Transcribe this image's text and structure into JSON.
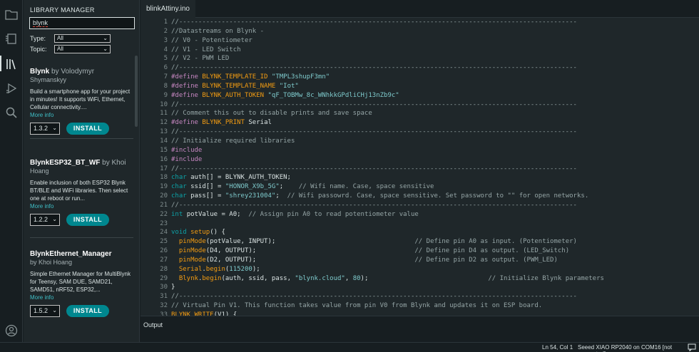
{
  "activity_bar": {
    "items": [
      {
        "name": "sketchbook-icon"
      },
      {
        "name": "boards-manager-icon"
      },
      {
        "name": "library-manager-icon"
      },
      {
        "name": "debug-icon"
      },
      {
        "name": "search-icon"
      },
      {
        "name": "profile-icon"
      }
    ]
  },
  "library_manager": {
    "title": "LIBRARY MANAGER",
    "search_value": "blynk",
    "type_label": "Type:",
    "type_value": "All",
    "topic_label": "Topic:",
    "topic_value": "All",
    "items": [
      {
        "name": "Blynk",
        "by": "by Volodymyr",
        "author": "Shymanskyy",
        "description": "Build a smartphone app for your project in minutes! It supports WiFi, Ethernet, Cellular connectivity....",
        "more": "More info",
        "version": "1.3.2",
        "install_label": "INSTALL"
      },
      {
        "name": "BlynkESP32_BT_WF",
        "by": "by Khoi",
        "author": "Hoang",
        "description": "Enable inclusion of both ESP32 Blynk BT/BLE and WiFi libraries. Then select one at reboot or run...",
        "more": "More info",
        "version": "1.2.2",
        "install_label": "INSTALL"
      },
      {
        "name": "BlynkEthernet_Manager",
        "by": "",
        "author": "by Khoi Hoang",
        "description": "Simple Ethernet Manager for MultiBlynk for Teensy, SAM DUE, SAMD21, SAMD51, nRF52, ESP32,...",
        "more": "More info",
        "version": "1.5.2",
        "install_label": "INSTALL"
      }
    ]
  },
  "editor": {
    "tab_label": "blinkAttiny.ino",
    "line_numbers": [
      "1",
      "2",
      "3",
      "4",
      "5",
      "6",
      "7",
      "8",
      "9",
      "10",
      "11",
      "12",
      "13",
      "14",
      "15",
      "16",
      "17",
      "18",
      "19",
      "20",
      "21",
      "22",
      "23",
      "24",
      "25",
      "26",
      "27",
      "28",
      "29",
      "30",
      "31",
      "32",
      "33"
    ],
    "lines": [
      [
        {
          "t": "//-------------------------------------------------------------------------------------------------------",
          "c": "c-cm"
        }
      ],
      [
        {
          "t": "//Datastreams on Blynk -",
          "c": "c-cm"
        }
      ],
      [
        {
          "t": "// V0 - Potentiometer",
          "c": "c-cm"
        }
      ],
      [
        {
          "t": "// V1 - LED Switch",
          "c": "c-cm"
        }
      ],
      [
        {
          "t": "// V2 - PWM LED",
          "c": "c-cm"
        }
      ],
      [
        {
          "t": "//-------------------------------------------------------------------------------------------------------",
          "c": "c-cm"
        }
      ],
      [
        {
          "t": "#define ",
          "c": "c-pp"
        },
        {
          "t": "BLYNK_TEMPLATE_ID ",
          "c": "c-macro"
        },
        {
          "t": "\"TMPL3shupF3mn\"",
          "c": "c-str"
        }
      ],
      [
        {
          "t": "#define ",
          "c": "c-pp"
        },
        {
          "t": "BLYNK_TEMPLATE_NAME ",
          "c": "c-macro"
        },
        {
          "t": "\"Iot\"",
          "c": "c-str"
        }
      ],
      [
        {
          "t": "#define ",
          "c": "c-pp"
        },
        {
          "t": "BLYNK_AUTH_TOKEN ",
          "c": "c-macro"
        },
        {
          "t": "\"qF_TOBMw_8c_WNhkkGPdliCHj13nZb9c\"",
          "c": "c-str"
        }
      ],
      [
        {
          "t": "//-------------------------------------------------------------------------------------------------------",
          "c": "c-cm"
        }
      ],
      [
        {
          "t": "// Comment this out to disable prints and save space",
          "c": "c-cm"
        }
      ],
      [
        {
          "t": "#define ",
          "c": "c-pp"
        },
        {
          "t": "BLYNK_PRINT ",
          "c": "c-macro"
        },
        {
          "t": "Serial",
          "c": "c-const"
        }
      ],
      [
        {
          "t": "//-------------------------------------------------------------------------------------------------------",
          "c": "c-cm"
        }
      ],
      [
        {
          "t": "// Initialize required libraries",
          "c": "c-cm"
        }
      ],
      [
        {
          "t": "#include",
          "c": "c-pp"
        }
      ],
      [
        {
          "t": "#include",
          "c": "c-pp"
        }
      ],
      [
        {
          "t": "//-------------------------------------------------------------------------------------------------------",
          "c": "c-cm"
        }
      ],
      [
        {
          "t": "char ",
          "c": "c-type"
        },
        {
          "t": "auth[] = BLYNK_AUTH_TOKEN;",
          "c": "c-const"
        }
      ],
      [
        {
          "t": "char ",
          "c": "c-type"
        },
        {
          "t": "ssid[] = ",
          "c": "c-const"
        },
        {
          "t": "\"HONOR_X9b_5G\"",
          "c": "c-str"
        },
        {
          "t": ";    ",
          "c": "c-const"
        },
        {
          "t": "// Wifi name. Case, space sensitive",
          "c": "c-cm"
        }
      ],
      [
        {
          "t": "char ",
          "c": "c-type"
        },
        {
          "t": "pass[] = ",
          "c": "c-const"
        },
        {
          "t": "\"shrey231004\"",
          "c": "c-str"
        },
        {
          "t": ";  ",
          "c": "c-const"
        },
        {
          "t": "// Wifi passowrd. Case, space sensitive. Set password to \"\" for open networks.",
          "c": "c-cm"
        }
      ],
      [
        {
          "t": "//-------------------------------------------------------------------------------------------------------",
          "c": "c-cm"
        }
      ],
      [
        {
          "t": "int ",
          "c": "c-type"
        },
        {
          "t": "potValue = A0;  ",
          "c": "c-const"
        },
        {
          "t": "// Assign pin A0 to read potentiometer value",
          "c": "c-cm"
        }
      ],
      [
        {
          "t": "",
          "c": "c-const"
        }
      ],
      [
        {
          "t": "void ",
          "c": "c-type"
        },
        {
          "t": "setup",
          "c": "c-fn"
        },
        {
          "t": "() {",
          "c": "c-const"
        }
      ],
      [
        {
          "t": "  ",
          "c": "c-const"
        },
        {
          "t": "pinMode",
          "c": "c-fn"
        },
        {
          "t": "(potValue, INPUT);                                    ",
          "c": "c-const"
        },
        {
          "t": "// Define pin A0 as input. (Potentiometer)",
          "c": "c-cm"
        }
      ],
      [
        {
          "t": "  ",
          "c": "c-const"
        },
        {
          "t": "pinMode",
          "c": "c-fn"
        },
        {
          "t": "(D4, OUTPUT);                                         ",
          "c": "c-const"
        },
        {
          "t": "// Define pin D4 as output. (LED_Switch)",
          "c": "c-cm"
        }
      ],
      [
        {
          "t": "  ",
          "c": "c-const"
        },
        {
          "t": "pinMode",
          "c": "c-fn"
        },
        {
          "t": "(D2, OUTPUT);                                         ",
          "c": "c-const"
        },
        {
          "t": "// Define pin D2 as output. (PWM_LED)",
          "c": "c-cm"
        }
      ],
      [
        {
          "t": "  ",
          "c": "c-const"
        },
        {
          "t": "Serial",
          "c": "c-fn"
        },
        {
          "t": ".",
          "c": "c-const"
        },
        {
          "t": "begin",
          "c": "c-fn"
        },
        {
          "t": "(",
          "c": "c-const"
        },
        {
          "t": "115200",
          "c": "c-num"
        },
        {
          "t": ");",
          "c": "c-const"
        }
      ],
      [
        {
          "t": "  ",
          "c": "c-const"
        },
        {
          "t": "Blynk",
          "c": "c-fn"
        },
        {
          "t": ".",
          "c": "c-const"
        },
        {
          "t": "begin",
          "c": "c-fn"
        },
        {
          "t": "(auth, ssid, pass, ",
          "c": "c-const"
        },
        {
          "t": "\"blynk.cloud\"",
          "c": "c-str"
        },
        {
          "t": ", ",
          "c": "c-const"
        },
        {
          "t": "80",
          "c": "c-num"
        },
        {
          "t": ");                               ",
          "c": "c-const"
        },
        {
          "t": "// Initialize Blynk parameters",
          "c": "c-cm"
        }
      ],
      [
        {
          "t": "}",
          "c": "c-const"
        }
      ],
      [
        {
          "t": "//-------------------------------------------------------------------------------------------------------",
          "c": "c-cm"
        }
      ],
      [
        {
          "t": "// Virtual Pin V1. This function takes value from pin V0 from Blynk and updates it on ESP board.",
          "c": "c-cm"
        }
      ],
      [
        {
          "t": "BLYNK_WRITE",
          "c": "c-fn"
        },
        {
          "t": "(V1) {",
          "c": "c-const"
        }
      ]
    ]
  },
  "output": {
    "label": "Output"
  },
  "status_bar": {
    "cursor": "Ln 54, Col 1",
    "board": "Seeed XIAO RP2040 on COM16 [not connected]"
  }
}
